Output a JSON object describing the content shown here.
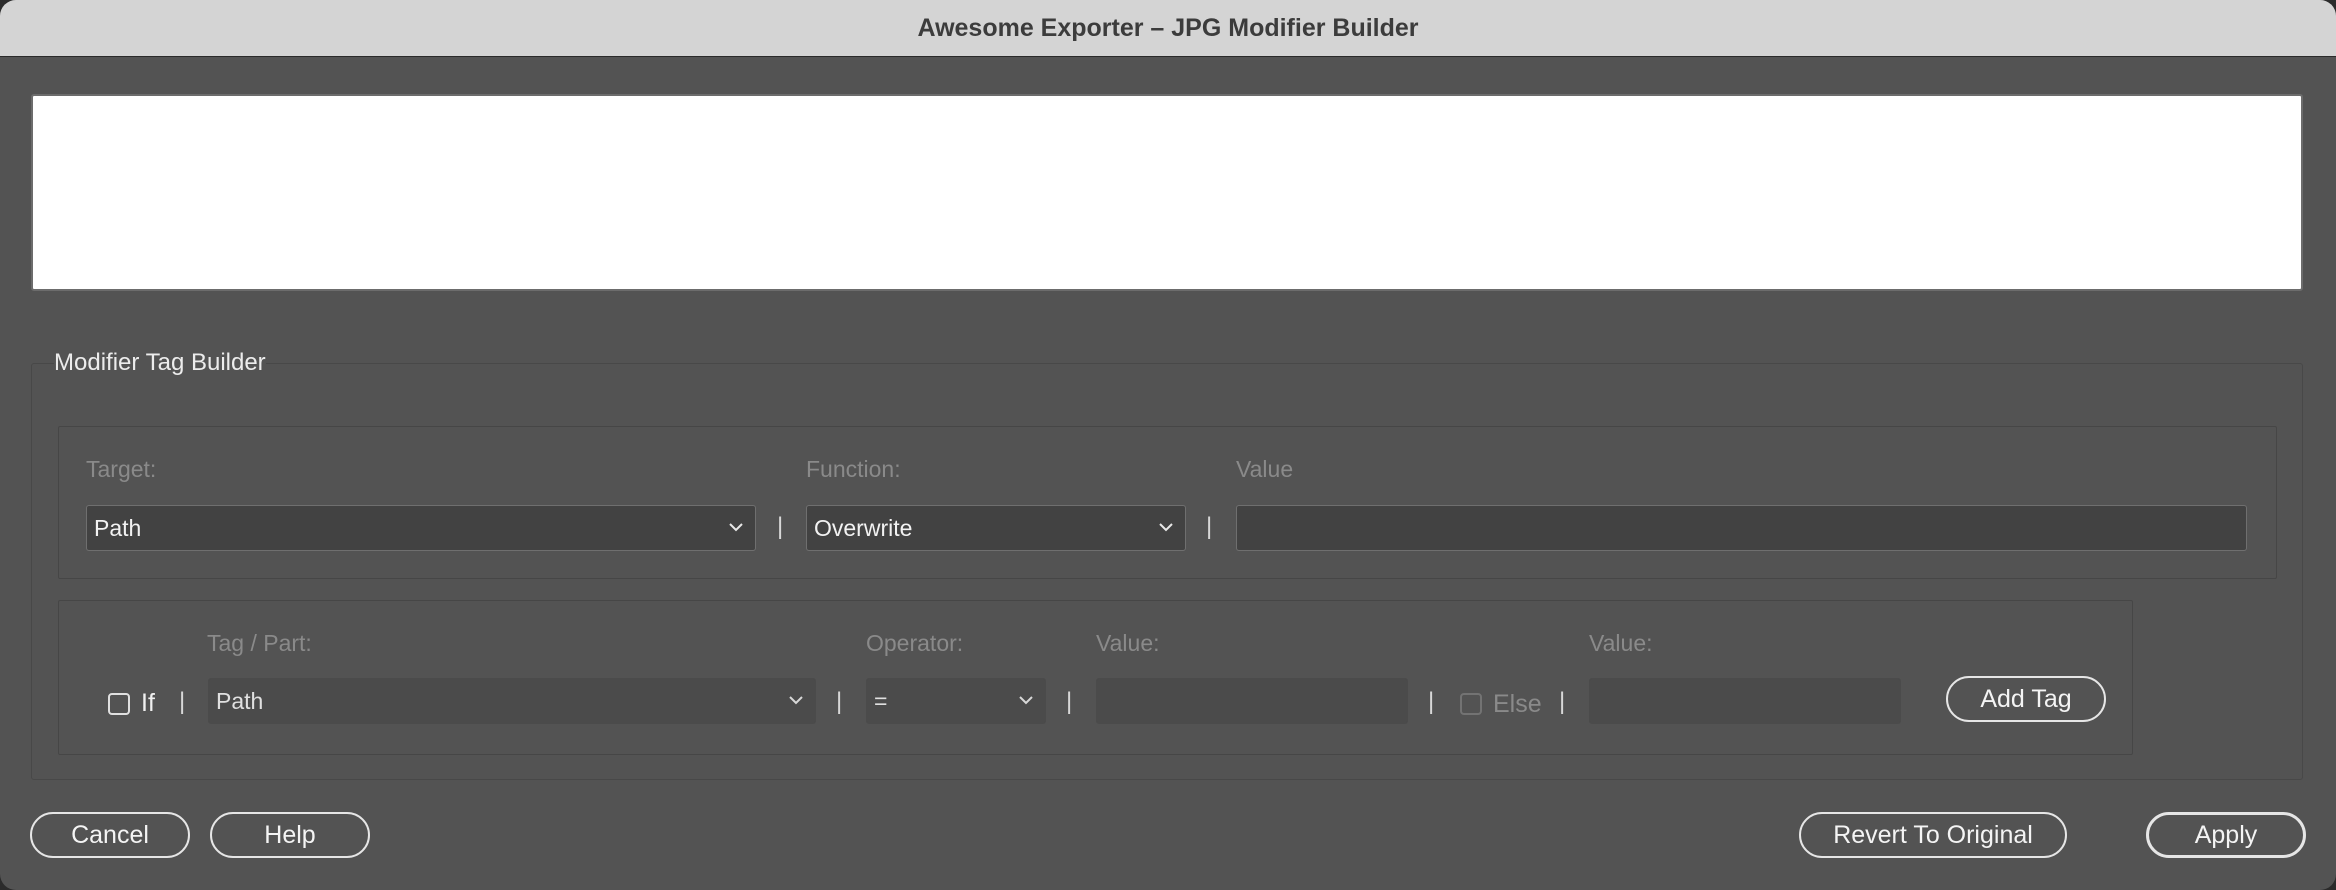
{
  "window": {
    "title": "Awesome Exporter – JPG Modifier Builder"
  },
  "preview": {
    "value": ""
  },
  "builder": {
    "title": "Modifier Tag Builder",
    "row1": {
      "target_label": "Target:",
      "target_value": "Path",
      "function_label": "Function:",
      "function_value": "Overwrite",
      "value_label": "Value",
      "value": "",
      "separator": "|"
    },
    "row2": {
      "if_label": "If",
      "if_checked": false,
      "tag_label": "Tag / Part:",
      "tag_value": "Path",
      "operator_label": "Operator:",
      "operator_value": "=",
      "value_label": "Value:",
      "value": "",
      "else_label": "Else",
      "else_checked": false,
      "else_value_label": "Value:",
      "else_value": "",
      "add_tag_label": "Add Tag",
      "separator": "|"
    }
  },
  "footer": {
    "cancel_label": "Cancel",
    "help_label": "Help",
    "revert_label": "Revert To Original",
    "apply_label": "Apply"
  },
  "icons": {
    "dropdown": "chevron-down-icon"
  }
}
